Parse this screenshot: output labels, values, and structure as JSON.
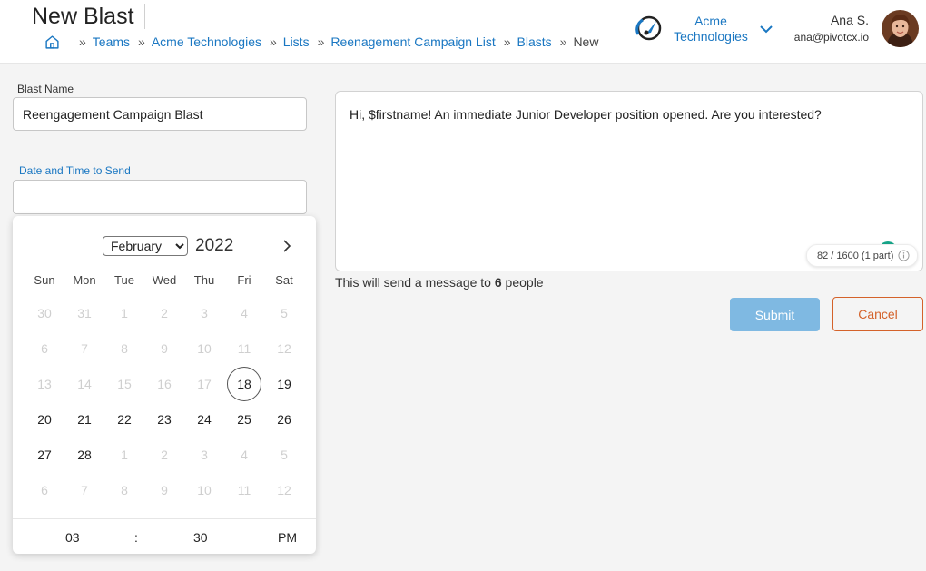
{
  "header": {
    "title": "New Blast",
    "breadcrumb": [
      "Teams",
      "Acme Technologies",
      "Lists",
      "Reenagement Campaign List",
      "Blasts",
      "New"
    ],
    "org_name_line1": "Acme",
    "org_name_line2": "Technologies",
    "user_name": "Ana S.",
    "user_email": "ana@pivotcx.io"
  },
  "form": {
    "blast_name_label": "Blast Name",
    "blast_name_value": "Reengagement Campaign Blast",
    "date_label": "Date and Time to Send",
    "date_value": ""
  },
  "calendar": {
    "month": "February",
    "year": "2022",
    "weekdays": [
      "Sun",
      "Mon",
      "Tue",
      "Wed",
      "Thu",
      "Fri",
      "Sat"
    ],
    "weeks": [
      [
        {
          "d": "30",
          "m": true
        },
        {
          "d": "31",
          "m": true
        },
        {
          "d": "1",
          "m": true
        },
        {
          "d": "2",
          "m": true
        },
        {
          "d": "3",
          "m": true
        },
        {
          "d": "4",
          "m": true
        },
        {
          "d": "5",
          "m": true
        }
      ],
      [
        {
          "d": "6",
          "m": true
        },
        {
          "d": "7",
          "m": true
        },
        {
          "d": "8",
          "m": true
        },
        {
          "d": "9",
          "m": true
        },
        {
          "d": "10",
          "m": true
        },
        {
          "d": "11",
          "m": true
        },
        {
          "d": "12",
          "m": true
        }
      ],
      [
        {
          "d": "13",
          "m": true
        },
        {
          "d": "14",
          "m": true
        },
        {
          "d": "15",
          "m": true
        },
        {
          "d": "16",
          "m": true
        },
        {
          "d": "17",
          "m": true
        },
        {
          "d": "18",
          "m": false,
          "sel": true
        },
        {
          "d": "19",
          "m": false
        }
      ],
      [
        {
          "d": "20",
          "m": false
        },
        {
          "d": "21",
          "m": false
        },
        {
          "d": "22",
          "m": false
        },
        {
          "d": "23",
          "m": false
        },
        {
          "d": "24",
          "m": false
        },
        {
          "d": "25",
          "m": false
        },
        {
          "d": "26",
          "m": false
        }
      ],
      [
        {
          "d": "27",
          "m": false
        },
        {
          "d": "28",
          "m": false
        },
        {
          "d": "1",
          "m": true
        },
        {
          "d": "2",
          "m": true
        },
        {
          "d": "3",
          "m": true
        },
        {
          "d": "4",
          "m": true
        },
        {
          "d": "5",
          "m": true
        }
      ],
      [
        {
          "d": "6",
          "m": true
        },
        {
          "d": "7",
          "m": true
        },
        {
          "d": "8",
          "m": true
        },
        {
          "d": "9",
          "m": true
        },
        {
          "d": "10",
          "m": true
        },
        {
          "d": "11",
          "m": true
        },
        {
          "d": "12",
          "m": true
        }
      ]
    ],
    "time_hour": "03",
    "time_sep": ":",
    "time_minute": "30",
    "time_ampm": "PM"
  },
  "message": {
    "text": "Hi, $firstname! An immediate Junior Developer position opened. Are you interested?",
    "counter": "82 / 1600 (1 part)",
    "recipients_prefix": "This will send a message to ",
    "recipients_count": "6",
    "recipients_suffix": " people"
  },
  "buttons": {
    "submit": "Submit",
    "cancel": "Cancel"
  },
  "colors": {
    "link": "#1a77c2",
    "submit_bg": "#7fb9e2",
    "cancel": "#d4622a",
    "counter_dot": "#17a589"
  }
}
